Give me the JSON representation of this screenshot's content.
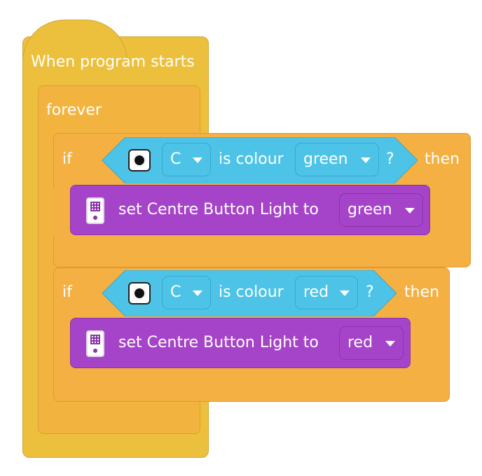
{
  "event_block": {
    "label": "When program starts"
  },
  "forever_block": {
    "label": "forever"
  },
  "if_blocks": [
    {
      "if_label": "if",
      "then_label": "then",
      "port": "C",
      "condition_text": "is colour",
      "colour": "green",
      "question": "?",
      "action": {
        "text": "set Centre Button Light to",
        "value": "green"
      }
    },
    {
      "if_label": "if",
      "then_label": "then",
      "port": "C",
      "condition_text": "is colour",
      "colour": "red",
      "question": "?",
      "action": {
        "text": "set Centre Button Light to",
        "value": "red"
      }
    }
  ],
  "colors": {
    "event": "#ECC03D",
    "control": "#F4B042",
    "sensor": "#4EC3E8",
    "light": "#A644C9"
  },
  "icons": {
    "sensor": "colour-sensor-icon",
    "hub": "hub-light-icon"
  }
}
